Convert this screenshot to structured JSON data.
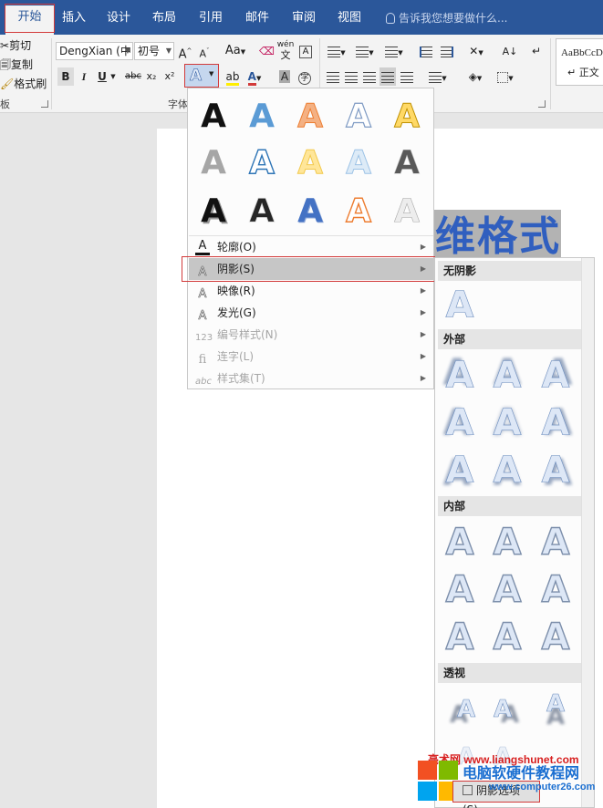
{
  "tabs": [
    "开始",
    "插入",
    "设计",
    "布局",
    "引用",
    "邮件",
    "审阅",
    "视图"
  ],
  "tell_me": "告诉我您想要做什么...",
  "clipboard": {
    "cut": "剪切",
    "copy": "复制",
    "format_painter": "格式刷",
    "group": "板"
  },
  "font": {
    "name": "DengXian (中",
    "size": "初号",
    "grow": "A",
    "shrink": "A",
    "change_case": "Aa",
    "phonetic_top": "wén",
    "phonetic_bottom": "文",
    "group": "字体",
    "bold": "B",
    "italic": "I",
    "underline": "U",
    "strike": "abc",
    "subscript": "x₂",
    "superscript": "x²"
  },
  "styles": {
    "preview": "AaBbCcD",
    "normal": "↵ 正文"
  },
  "document": {
    "title_fragment": "维格式"
  },
  "text_effects_menu": {
    "items": [
      {
        "label": "轮廓(O)",
        "icon": "outline-icon",
        "disabled": false
      },
      {
        "label": "阴影(S)",
        "icon": "shadow-icon",
        "disabled": false
      },
      {
        "label": "映像(R)",
        "icon": "reflection-icon",
        "disabled": false
      },
      {
        "label": "发光(G)",
        "icon": "glow-icon",
        "disabled": false
      },
      {
        "label": "编号样式(N)",
        "icon": "number-style-icon",
        "disabled": true
      },
      {
        "label": "连字(L)",
        "icon": "ligature-icon",
        "disabled": true
      },
      {
        "label": "样式集(T)",
        "icon": "stylistic-set-icon",
        "disabled": true
      }
    ]
  },
  "shadow_submenu": {
    "sections": [
      "无阴影",
      "外部",
      "内部",
      "透视"
    ],
    "options_button": "阴影选项(S)..."
  },
  "watermark": {
    "url": "亮术网 www.liangshunet.com",
    "name": "电脑软硬件教程网",
    "site": "www.computer26.com"
  },
  "colors": {
    "ribbon_blue": "#2b579a",
    "highlight_red": "#d23a3a",
    "accent_text_blue": "#305fbf"
  }
}
